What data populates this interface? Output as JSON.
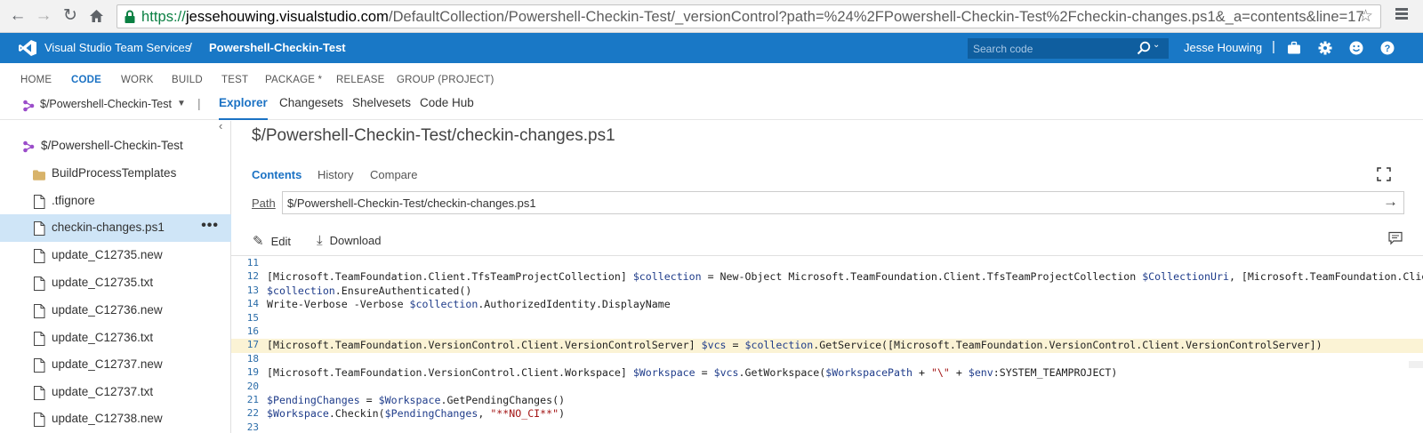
{
  "browser": {
    "url_scheme": "https://",
    "url_host": "jessehouwing.visualstudio.com",
    "url_path": "/DefaultCollection/Powershell-Checkin-Test/_versionControl?path=%24%2FPowershell-Checkin-Test%2Fcheckin-changes.ps1&_a=contents&line=17"
  },
  "header": {
    "product": "Visual Studio Team Services",
    "separator": "/",
    "project": "Powershell-Checkin-Test",
    "search_placeholder": "Search code",
    "user": "Jesse Houwing",
    "divider": "|"
  },
  "hubs": [
    "HOME",
    "CODE",
    "WORK",
    "BUILD",
    "TEST",
    "PACKAGE *",
    "RELEASE",
    "GROUP (PROJECT)"
  ],
  "subnav": {
    "repo": "$/Powershell-Checkin-Test",
    "separator": "|",
    "items": [
      "Explorer",
      "Changesets",
      "Shelvesets",
      "Code Hub"
    ]
  },
  "tree": [
    {
      "label": "$/Powershell-Checkin-Test",
      "icon": "repo-icon"
    },
    {
      "label": "BuildProcessTemplates",
      "icon": "folder-icon"
    },
    {
      "label": ".tfignore",
      "icon": "file-icon"
    },
    {
      "label": "checkin-changes.ps1",
      "icon": "file-icon",
      "selected": true,
      "more": "•••"
    },
    {
      "label": "update_C12735.new",
      "icon": "file-icon"
    },
    {
      "label": "update_C12735.txt",
      "icon": "file-icon"
    },
    {
      "label": "update_C12736.new",
      "icon": "file-icon"
    },
    {
      "label": "update_C12736.txt",
      "icon": "file-icon"
    },
    {
      "label": "update_C12737.new",
      "icon": "file-icon"
    },
    {
      "label": "update_C12737.txt",
      "icon": "file-icon"
    },
    {
      "label": "update_C12738.new",
      "icon": "file-icon"
    }
  ],
  "file": {
    "title": "$/Powershell-Checkin-Test/checkin-changes.ps1",
    "tabs": [
      "Contents",
      "History",
      "Compare"
    ],
    "path_label": "Path",
    "path_value": "$/Powershell-Checkin-Test/checkin-changes.ps1",
    "actions": {
      "edit": "Edit",
      "download": "Download"
    }
  },
  "code": {
    "highlight_line": "17",
    "lines": [
      {
        "n": "11",
        "t": ""
      },
      {
        "n": "12",
        "t": "[Microsoft.TeamFoundation.Client.TfsTeamProjectCollection] $collection = New-Object Microsoft.TeamFoundation.Client.TfsTeamProjectCollection $CollectionUri, [Microsoft.TeamFoundation.Client."
      },
      {
        "n": "13",
        "t": "$collection.EnsureAuthenticated()"
      },
      {
        "n": "14",
        "t": "Write-Verbose -Verbose $collection.AuthorizedIdentity.DisplayName"
      },
      {
        "n": "15",
        "t": ""
      },
      {
        "n": "16",
        "t": ""
      },
      {
        "n": "17",
        "t": "[Microsoft.TeamFoundation.VersionControl.Client.VersionControlServer] $vcs = $collection.GetService([Microsoft.TeamFoundation.VersionControl.Client.VersionControlServer])"
      },
      {
        "n": "18",
        "t": ""
      },
      {
        "n": "19",
        "t": "[Microsoft.TeamFoundation.VersionControl.Client.Workspace] $Workspace = $vcs.GetWorkspace($WorkspacePath + \"\\\" + $env:SYSTEM_TEAMPROJECT)"
      },
      {
        "n": "20",
        "t": ""
      },
      {
        "n": "21",
        "t": "$PendingChanges = $Workspace.GetPendingChanges()"
      },
      {
        "n": "22",
        "t": "$Workspace.Checkin($PendingChanges, \"**NO_CI**\")"
      },
      {
        "n": "23",
        "t": ""
      }
    ]
  }
}
